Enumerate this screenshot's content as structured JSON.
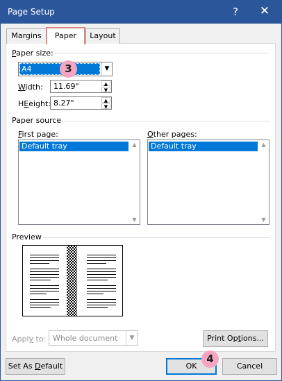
{
  "window": {
    "title": "Page Setup",
    "help_glyph": "?",
    "close_glyph": "✕"
  },
  "tabs": [
    {
      "label": "Margins",
      "active": false
    },
    {
      "label": "Paper",
      "active": true
    },
    {
      "label": "Layout",
      "active": false
    }
  ],
  "paper_size": {
    "heading_pre": "",
    "heading_key": "P",
    "heading_post": "aper size:",
    "selected": "A4",
    "width_key": "W",
    "width_post": "idth:",
    "width_value": "11.69\"",
    "height_key": "E",
    "height_post": "eight:",
    "height_pre": "H",
    "height_value": "8.27\""
  },
  "paper_source": {
    "heading": "Paper source",
    "first_page_key": "F",
    "first_page_post": "irst page:",
    "first_page_items": [
      "Default tray"
    ],
    "other_pages_key": "O",
    "other_pages_post": "ther pages:",
    "other_pages_items": [
      "Default tray"
    ]
  },
  "preview": {
    "heading": "Preview"
  },
  "apply_to": {
    "label_pre": "Appl",
    "label_key": "y",
    "label_post": " to:",
    "value": "Whole document"
  },
  "buttons": {
    "print_options_pre": "Print Op",
    "print_options_key": "t",
    "print_options_post": "ions...",
    "set_default_pre": "Set As ",
    "set_default_key": "D",
    "set_default_post": "efault",
    "ok": "OK",
    "cancel": "Cancel"
  },
  "annotations": {
    "step3": "3",
    "step4": "4",
    "badge_color": "#f4a6c0"
  },
  "colors": {
    "titlebar": "#2b579a",
    "selection": "#0078d7"
  }
}
